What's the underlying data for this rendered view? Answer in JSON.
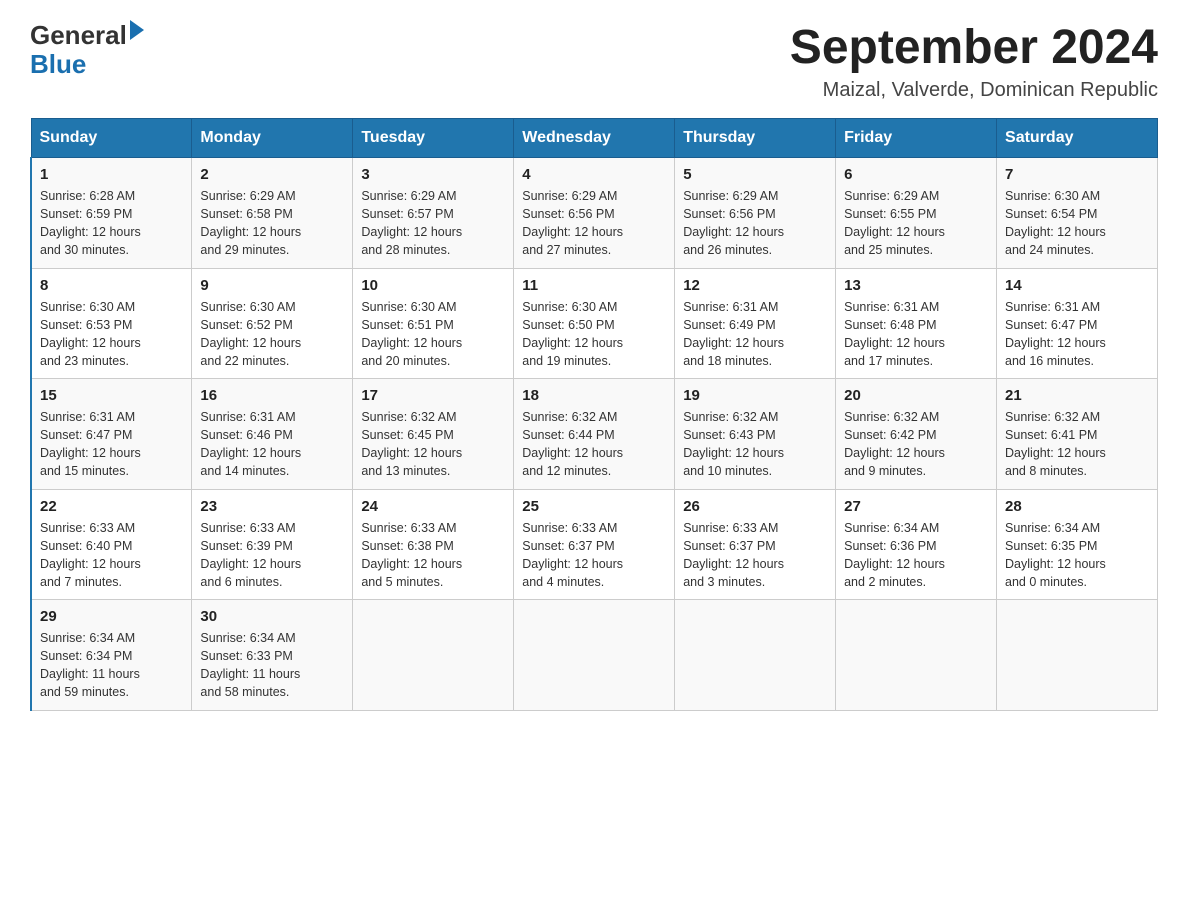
{
  "header": {
    "logo_general": "General",
    "logo_blue": "Blue",
    "title": "September 2024",
    "subtitle": "Maizal, Valverde, Dominican Republic"
  },
  "days_of_week": [
    "Sunday",
    "Monday",
    "Tuesday",
    "Wednesday",
    "Thursday",
    "Friday",
    "Saturday"
  ],
  "weeks": [
    [
      {
        "day": "1",
        "sunrise": "6:28 AM",
        "sunset": "6:59 PM",
        "daylight": "12 hours and 30 minutes."
      },
      {
        "day": "2",
        "sunrise": "6:29 AM",
        "sunset": "6:58 PM",
        "daylight": "12 hours and 29 minutes."
      },
      {
        "day": "3",
        "sunrise": "6:29 AM",
        "sunset": "6:57 PM",
        "daylight": "12 hours and 28 minutes."
      },
      {
        "day": "4",
        "sunrise": "6:29 AM",
        "sunset": "6:56 PM",
        "daylight": "12 hours and 27 minutes."
      },
      {
        "day": "5",
        "sunrise": "6:29 AM",
        "sunset": "6:56 PM",
        "daylight": "12 hours and 26 minutes."
      },
      {
        "day": "6",
        "sunrise": "6:29 AM",
        "sunset": "6:55 PM",
        "daylight": "12 hours and 25 minutes."
      },
      {
        "day": "7",
        "sunrise": "6:30 AM",
        "sunset": "6:54 PM",
        "daylight": "12 hours and 24 minutes."
      }
    ],
    [
      {
        "day": "8",
        "sunrise": "6:30 AM",
        "sunset": "6:53 PM",
        "daylight": "12 hours and 23 minutes."
      },
      {
        "day": "9",
        "sunrise": "6:30 AM",
        "sunset": "6:52 PM",
        "daylight": "12 hours and 22 minutes."
      },
      {
        "day": "10",
        "sunrise": "6:30 AM",
        "sunset": "6:51 PM",
        "daylight": "12 hours and 20 minutes."
      },
      {
        "day": "11",
        "sunrise": "6:30 AM",
        "sunset": "6:50 PM",
        "daylight": "12 hours and 19 minutes."
      },
      {
        "day": "12",
        "sunrise": "6:31 AM",
        "sunset": "6:49 PM",
        "daylight": "12 hours and 18 minutes."
      },
      {
        "day": "13",
        "sunrise": "6:31 AM",
        "sunset": "6:48 PM",
        "daylight": "12 hours and 17 minutes."
      },
      {
        "day": "14",
        "sunrise": "6:31 AM",
        "sunset": "6:47 PM",
        "daylight": "12 hours and 16 minutes."
      }
    ],
    [
      {
        "day": "15",
        "sunrise": "6:31 AM",
        "sunset": "6:47 PM",
        "daylight": "12 hours and 15 minutes."
      },
      {
        "day": "16",
        "sunrise": "6:31 AM",
        "sunset": "6:46 PM",
        "daylight": "12 hours and 14 minutes."
      },
      {
        "day": "17",
        "sunrise": "6:32 AM",
        "sunset": "6:45 PM",
        "daylight": "12 hours and 13 minutes."
      },
      {
        "day": "18",
        "sunrise": "6:32 AM",
        "sunset": "6:44 PM",
        "daylight": "12 hours and 12 minutes."
      },
      {
        "day": "19",
        "sunrise": "6:32 AM",
        "sunset": "6:43 PM",
        "daylight": "12 hours and 10 minutes."
      },
      {
        "day": "20",
        "sunrise": "6:32 AM",
        "sunset": "6:42 PM",
        "daylight": "12 hours and 9 minutes."
      },
      {
        "day": "21",
        "sunrise": "6:32 AM",
        "sunset": "6:41 PM",
        "daylight": "12 hours and 8 minutes."
      }
    ],
    [
      {
        "day": "22",
        "sunrise": "6:33 AM",
        "sunset": "6:40 PM",
        "daylight": "12 hours and 7 minutes."
      },
      {
        "day": "23",
        "sunrise": "6:33 AM",
        "sunset": "6:39 PM",
        "daylight": "12 hours and 6 minutes."
      },
      {
        "day": "24",
        "sunrise": "6:33 AM",
        "sunset": "6:38 PM",
        "daylight": "12 hours and 5 minutes."
      },
      {
        "day": "25",
        "sunrise": "6:33 AM",
        "sunset": "6:37 PM",
        "daylight": "12 hours and 4 minutes."
      },
      {
        "day": "26",
        "sunrise": "6:33 AM",
        "sunset": "6:37 PM",
        "daylight": "12 hours and 3 minutes."
      },
      {
        "day": "27",
        "sunrise": "6:34 AM",
        "sunset": "6:36 PM",
        "daylight": "12 hours and 2 minutes."
      },
      {
        "day": "28",
        "sunrise": "6:34 AM",
        "sunset": "6:35 PM",
        "daylight": "12 hours and 0 minutes."
      }
    ],
    [
      {
        "day": "29",
        "sunrise": "6:34 AM",
        "sunset": "6:34 PM",
        "daylight": "11 hours and 59 minutes."
      },
      {
        "day": "30",
        "sunrise": "6:34 AM",
        "sunset": "6:33 PM",
        "daylight": "11 hours and 58 minutes."
      },
      null,
      null,
      null,
      null,
      null
    ]
  ],
  "labels": {
    "sunrise_prefix": "Sunrise: ",
    "sunset_prefix": "Sunset: ",
    "daylight_prefix": "Daylight: "
  }
}
